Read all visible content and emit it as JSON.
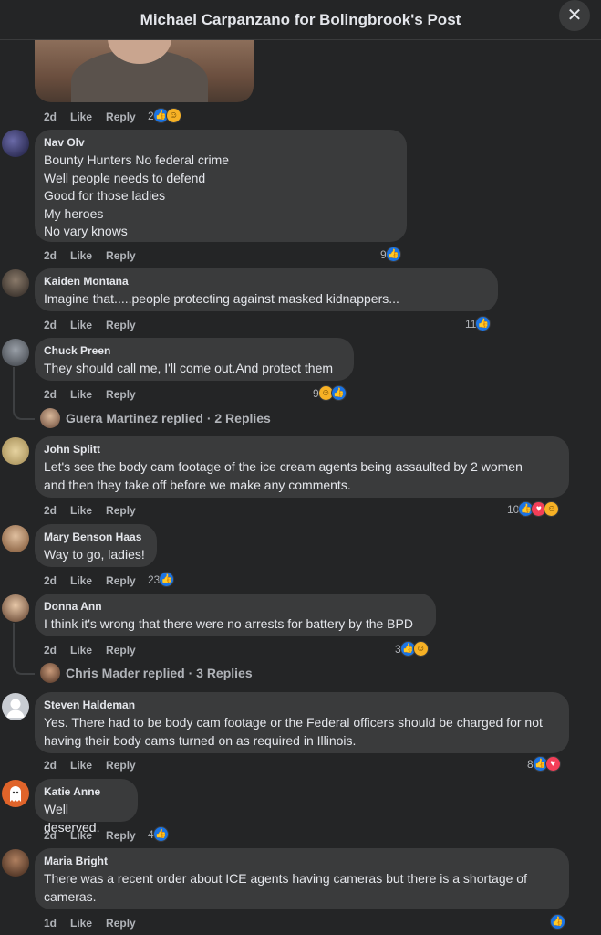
{
  "header": {
    "title": "Michael Carpanzano for Bolingbrook's Post",
    "close_label": "✕"
  },
  "top_comment": {
    "age": "2d",
    "like": "Like",
    "reply": "Reply",
    "reaction_count": "2"
  },
  "comments": [
    {
      "name": "Nav Olv",
      "text": "Bounty Hunters  No federal crime\nWell people needs to defend\nGood for those ladies\nMy heroes\nNo vary knows ",
      "age": "2d",
      "like": "Like",
      "reply": "Reply",
      "reaction_count": "9"
    },
    {
      "name": "Kaiden Montana",
      "text": "Imagine that.....people protecting against masked kidnappers...",
      "age": "2d",
      "like": "Like",
      "reply": "Reply",
      "reaction_count": "11"
    },
    {
      "name": "Chuck Preen",
      "text": "They should call me, I'll come out.And protect them",
      "age": "2d",
      "like": "Like",
      "reply": "Reply",
      "reaction_count": "9",
      "replies_text": "Guera Martinez replied · 2 Replies"
    },
    {
      "name": "John Splitt",
      "text": "Let's see the body cam footage of the ice cream agents being assaulted by 2 women\nand then they take off before we make any comments.",
      "age": "2d",
      "like": "Like",
      "reply": "Reply",
      "reaction_count": "10"
    },
    {
      "name": "Mary Benson Haas",
      "text": "Way to go, ladies!",
      "age": "2d",
      "like": "Like",
      "reply": "Reply",
      "reaction_count": "23"
    },
    {
      "name": "Donna Ann",
      "text": "I think it's wrong that there were no arrests for battery by the BPD",
      "age": "2d",
      "like": "Like",
      "reply": "Reply",
      "reaction_count": "3",
      "replies_text": "Chris Mader replied · 3 Replies"
    },
    {
      "name": "Steven Haldeman",
      "text": "Yes. There had to be body cam footage or the Federal officers should be charged for not\nhaving their body cams turned on as required in Illinois.",
      "age": "2d",
      "like": "Like",
      "reply": "Reply",
      "reaction_count": "8"
    },
    {
      "name": "Katie Anne",
      "text": "Well deserved.",
      "age": "2d",
      "like": "Like",
      "reply": "Reply",
      "reaction_count": "4"
    },
    {
      "name": "Maria Bright",
      "text": "There was a recent order about ICE agents having cameras but there is a shortage of\ncameras.",
      "age": "1d",
      "like": "Like",
      "reply": "Reply",
      "reaction_count": ""
    }
  ],
  "colors": {
    "background": "#242526",
    "bubble": "#3a3b3c",
    "like_blue": "#1b74e4",
    "love_red": "#f33e58",
    "haha_yellow": "#f7b125"
  }
}
